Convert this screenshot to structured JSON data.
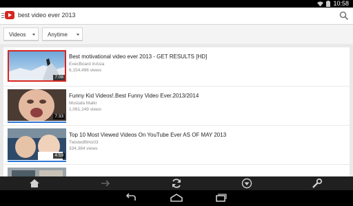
{
  "status": {
    "time": "10:58"
  },
  "header": {
    "query": "best video ever 2013"
  },
  "filters": [
    {
      "label": "Videos"
    },
    {
      "label": "Anytime"
    }
  ],
  "results": [
    {
      "title": "Best motivational video ever 2013 - GET RESULTS [HD]",
      "channel": "ExecBoard inAsia",
      "views": "6,154,496 views",
      "duration": "7:08",
      "progress": 0
    },
    {
      "title": "Funny Kid Videos!.Best Funny Video Ever.2013/2014",
      "channel": "Mostafa Malki",
      "views": "1,061,249 views",
      "duration": "7:33",
      "progress": 1
    },
    {
      "title": "Top 10 Most Viewed Videos On YouTube Ever AS OF MAY 2013",
      "channel": "Twistedfilms03",
      "views": "334,384 views",
      "duration": "4:59",
      "progress": 1
    },
    {
      "title": "",
      "channel": "",
      "views": "",
      "duration": "",
      "progress": 0
    }
  ],
  "icons": {
    "nav": [
      "home-icon",
      "forward-arrow-icon",
      "refresh-icon",
      "download-icon",
      "wrench-icon"
    ],
    "system": [
      "back-icon",
      "home-outline-icon",
      "recent-apps-icon"
    ]
  },
  "colors": {
    "accent": "#d7261f",
    "progress": "#2f79d6"
  }
}
